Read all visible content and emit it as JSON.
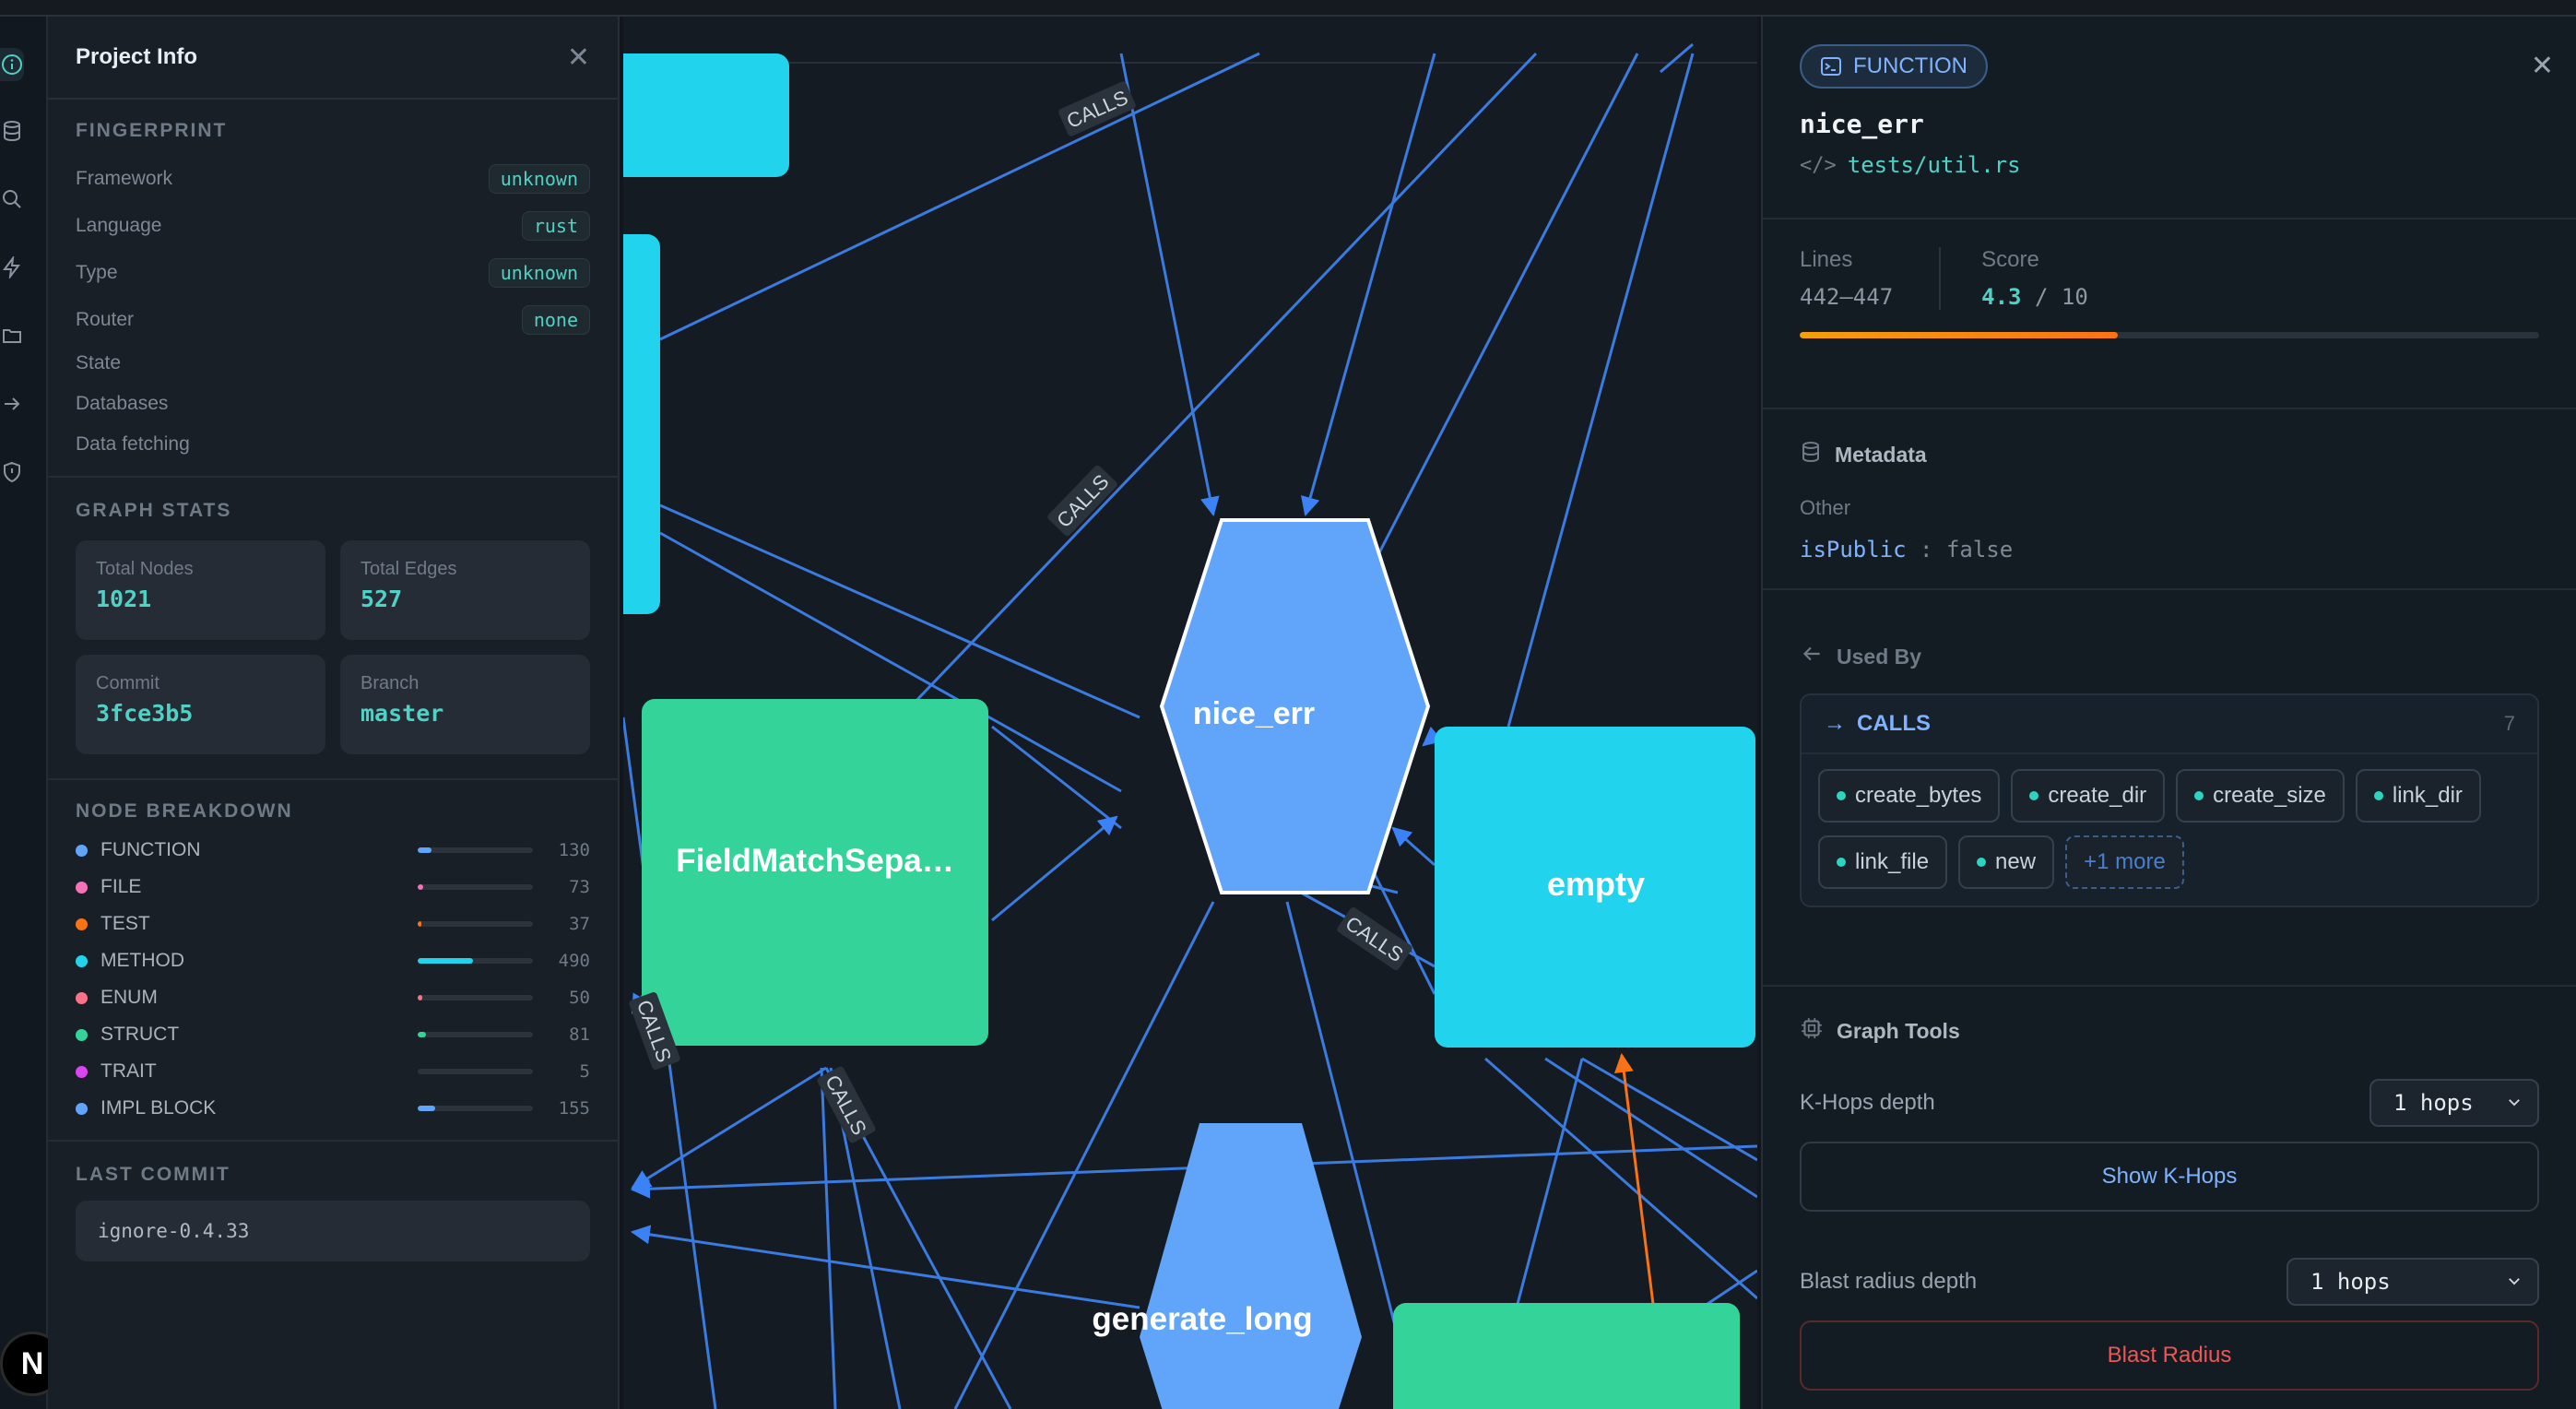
{
  "project_panel": {
    "title": "Project Info",
    "fingerprint": {
      "heading": "FINGERPRINT",
      "rows": [
        {
          "label": "Framework",
          "value": "unknown"
        },
        {
          "label": "Language",
          "value": "rust"
        },
        {
          "label": "Type",
          "value": "unknown"
        },
        {
          "label": "Router",
          "value": "none"
        },
        {
          "label": "State",
          "value": ""
        },
        {
          "label": "Databases",
          "value": ""
        },
        {
          "label": "Data fetching",
          "value": ""
        }
      ]
    },
    "graph_stats": {
      "heading": "GRAPH STATS",
      "total_nodes_label": "Total Nodes",
      "total_nodes": "1021",
      "total_edges_label": "Total Edges",
      "total_edges": "527",
      "commit_label": "Commit",
      "commit": "3fce3b5",
      "branch_label": "Branch",
      "branch": "master"
    },
    "node_breakdown": {
      "heading": "NODE BREAKDOWN",
      "items": [
        {
          "label": "FUNCTION",
          "count": "130",
          "fraction": 0.12,
          "color": "#60a5fa"
        },
        {
          "label": "FILE",
          "count": "73",
          "fraction": 0.05,
          "color": "#f472b6"
        },
        {
          "label": "TEST",
          "count": "37",
          "fraction": 0.03,
          "color": "#f97316"
        },
        {
          "label": "METHOD",
          "count": "490",
          "fraction": 0.48,
          "color": "#22d3ee"
        },
        {
          "label": "ENUM",
          "count": "50",
          "fraction": 0.04,
          "color": "#fb7185"
        },
        {
          "label": "STRUCT",
          "count": "81",
          "fraction": 0.07,
          "color": "#34d399"
        },
        {
          "label": "TRAIT",
          "count": "5",
          "fraction": 0.0,
          "color": "#d946ef"
        },
        {
          "label": "IMPL BLOCK",
          "count": "155",
          "fraction": 0.15,
          "color": "#60a5fa"
        }
      ]
    },
    "last_commit": {
      "heading": "LAST COMMIT",
      "value": "ignore-0.4.33"
    }
  },
  "graph": {
    "nodes": [
      {
        "label": "nice_err",
        "kind": "FUNCTION"
      },
      {
        "label": "FieldMatchSepa…",
        "kind": "STRUCT"
      },
      {
        "label": "empty",
        "kind": "METHOD"
      },
      {
        "label": "generate_long",
        "kind": "FUNCTION"
      }
    ],
    "edge_label": "CALLS"
  },
  "details": {
    "badge": "FUNCTION",
    "name": "nice_err",
    "path": "tests/util.rs",
    "lines_label": "Lines",
    "lines": "442–447",
    "score_label": "Score",
    "score": "4.3",
    "score_max": "/ 10",
    "score_fraction": 0.43,
    "metadata_heading": "Metadata",
    "meta_group": "Other",
    "meta_key": "isPublic",
    "meta_sep": ":",
    "meta_value": "false",
    "used_by_heading": "Used By",
    "calls_label": "CALLS",
    "calls_count": "7",
    "callers": [
      "create_bytes",
      "create_dir",
      "create_size",
      "link_dir",
      "link_file",
      "new"
    ],
    "more": "+1 more",
    "tools_heading": "Graph Tools",
    "khops_label": "K-Hops depth",
    "khops_value": "1 hops",
    "khops_button": "Show K-Hops",
    "blast_label": "Blast radius depth",
    "blast_value": "1 hops",
    "blast_button": "Blast Radius"
  }
}
